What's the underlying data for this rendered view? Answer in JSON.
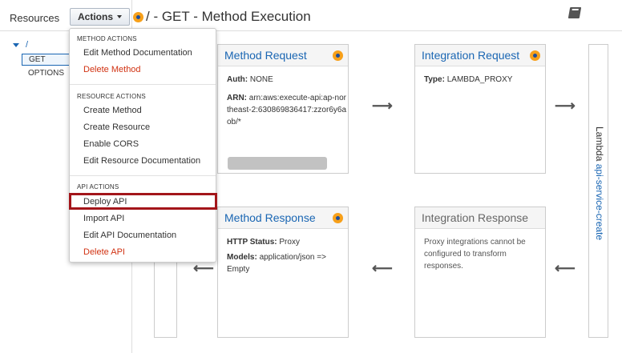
{
  "sidebar": {
    "title": "Resources",
    "tree": {
      "root_path": "/",
      "selected_method": "GET",
      "other_method": "OPTIONS"
    }
  },
  "toolbar": {
    "actions_label": "Actions"
  },
  "header": {
    "title": "/ - GET - Method Execution"
  },
  "actions_menu": {
    "method_actions": {
      "heading": "METHOD ACTIONS",
      "items": [
        "Edit Method Documentation",
        "Delete Method"
      ]
    },
    "resource_actions": {
      "heading": "RESOURCE ACTIONS",
      "items": [
        "Create Method",
        "Create Resource",
        "Enable CORS",
        "Edit Resource Documentation"
      ]
    },
    "api_actions": {
      "heading": "API ACTIONS",
      "items": [
        "Deploy API",
        "Import API",
        "Edit API Documentation",
        "Delete API"
      ]
    },
    "highlighted_item": "Deploy API"
  },
  "method_request": {
    "title": "Method Request",
    "auth_label": "Auth:",
    "auth_value": "NONE",
    "arn_label": "ARN:",
    "arn_value": "arn:aws:execute-api:ap-northeast-2:630869836417:zzor6y6aob/*"
  },
  "integration_request": {
    "title": "Integration Request",
    "type_label": "Type:",
    "type_value": "LAMBDA_PROXY"
  },
  "method_response": {
    "title": "Method Response",
    "status_label": "HTTP Status:",
    "status_value": "Proxy",
    "models_label": "Models:",
    "models_value": "application/json => Empty"
  },
  "integration_response": {
    "title": "Integration Response",
    "note": "Proxy integrations cannot be configured to transform responses."
  },
  "lambda": {
    "label": "Lambda",
    "function_name": "api-service-create"
  },
  "colors": {
    "accent": "#1a66b3",
    "danger": "#d13212",
    "highlight_border": "#a3151a",
    "status_dot": "#f7a01a"
  }
}
